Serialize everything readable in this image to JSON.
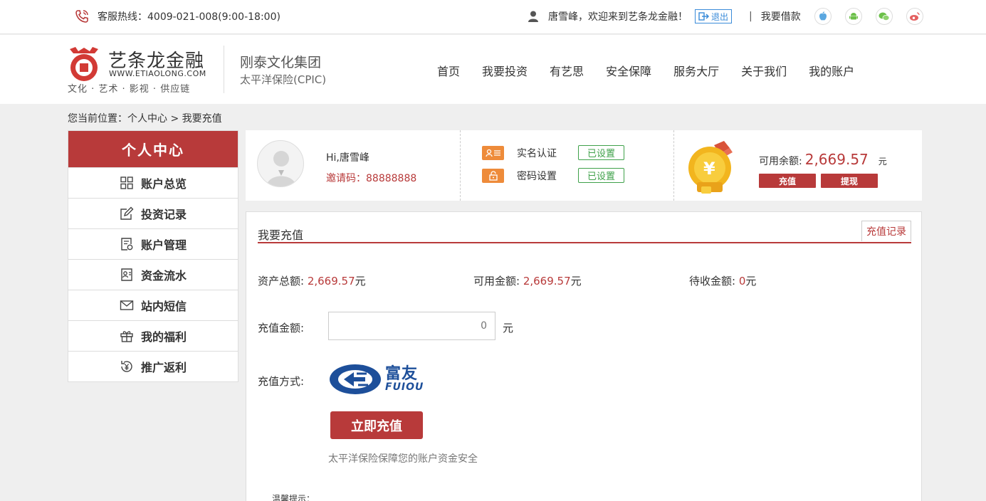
{
  "topbar": {
    "hotline": "客服热线：4009-021-008(9:00-18:00)",
    "welcome": "唐雪峰，欢迎来到艺条龙金融！",
    "logout": "退出",
    "separator": "|",
    "borrow": "我要借款",
    "social_icons": [
      "apple-icon",
      "android-icon",
      "wechat-icon",
      "weibo-icon"
    ]
  },
  "header": {
    "logo_cn": "艺条龙金融",
    "logo_url": "WWW.ETIAOLONG.COM",
    "logo_tagline": "文化 · 艺术 · 影视 · 供应链",
    "partner1": "刚泰文化集团",
    "partner2": "太平洋保险(CPIC)",
    "nav": [
      "首页",
      "我要投资",
      "有艺思",
      "安全保障",
      "服务大厅",
      "关于我们",
      "我的账户"
    ]
  },
  "breadcrumb": "您当前位置：个人中心 > 我要充值",
  "sidebar": {
    "title": "个人中心",
    "items": [
      {
        "label": "账户总览",
        "icon": "grid-icon"
      },
      {
        "label": "投资记录",
        "icon": "edit-icon"
      },
      {
        "label": "账户管理",
        "icon": "account-settings-icon"
      },
      {
        "label": "资金流水",
        "icon": "funds-flow-icon"
      },
      {
        "label": "站内短信",
        "icon": "mail-icon"
      },
      {
        "label": "我的福利",
        "icon": "gift-icon"
      },
      {
        "label": "推广返利",
        "icon": "rebate-icon"
      }
    ]
  },
  "profile": {
    "greeting": "Hi,唐雪峰",
    "invite": "邀请码：88888888",
    "security": [
      {
        "label": "实名认证",
        "status": "已设置",
        "icon": "id-card-icon"
      },
      {
        "label": "密码设置",
        "status": "已设置",
        "icon": "lock-icon"
      }
    ],
    "balance_label": "可用余额:",
    "balance_value": "2,669.57",
    "balance_unit": "元",
    "recharge_btn": "充值",
    "withdraw_btn": "提现"
  },
  "main": {
    "title": "我要充值",
    "record_btn": "充值记录",
    "stats": [
      {
        "label": "资产总额: ",
        "value": "2,669.57",
        "unit": "元"
      },
      {
        "label": "可用金额: ",
        "value": "2,669.57",
        "unit": "元"
      },
      {
        "label": "待收金额: ",
        "value": "0",
        "unit": "元"
      }
    ],
    "amount_label": "充值金额:",
    "amount_value": "",
    "amount_placeholder": "0",
    "amount_unit": "元",
    "method_label": "充值方式:",
    "method_logo_cn": "富友",
    "method_logo_en": "FUIOU",
    "pay_btn": "立即充值",
    "safe_note": "太平洋保险保障您的账户资金安全",
    "tips": "温馨提示："
  },
  "colors": {
    "brand_red": "#b83a3a",
    "success_green": "#3fa14a",
    "link_blue": "#3a8bd9",
    "fuiou_blue": "#1d4f9a"
  }
}
